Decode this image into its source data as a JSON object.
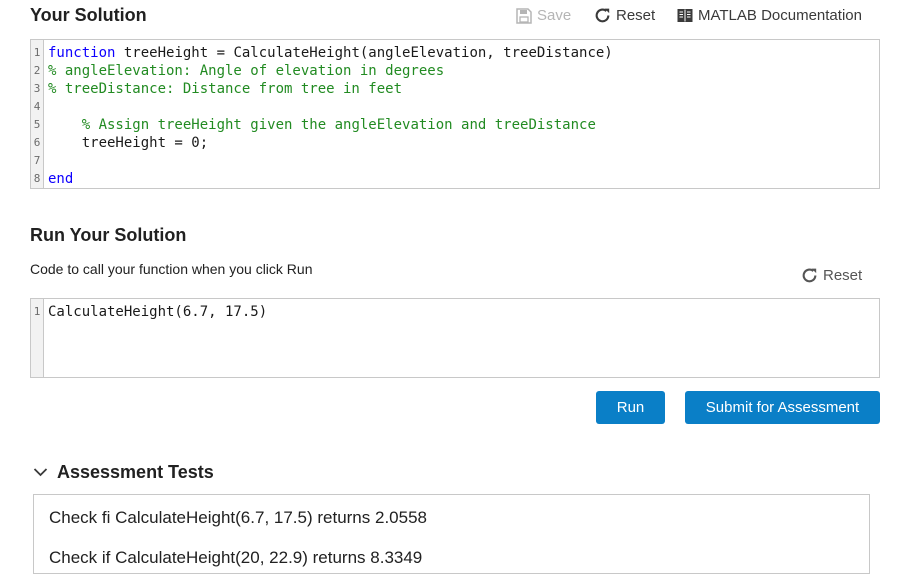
{
  "solution": {
    "title": "Your Solution",
    "save_label": "Save",
    "reset_label": "Reset",
    "docs_label": "MATLAB Documentation",
    "lines": [
      {
        "n": "1",
        "kw": "function",
        "text": " treeHeight = CalculateHeight(angleElevation, treeDistance)",
        "comment": ""
      },
      {
        "n": "2",
        "kw": "",
        "text": "",
        "comment": "% angleElevation: Angle of elevation in degrees"
      },
      {
        "n": "3",
        "kw": "",
        "text": "",
        "comment": "% treeDistance: Distance from tree in feet"
      },
      {
        "n": "4",
        "kw": "",
        "text": "",
        "comment": ""
      },
      {
        "n": "5",
        "kw": "",
        "text": "    ",
        "comment": "% Assign treeHeight given the angleElevation and treeDistance"
      },
      {
        "n": "6",
        "kw": "",
        "text": "    treeHeight = 0;",
        "comment": ""
      },
      {
        "n": "7",
        "kw": "",
        "text": "",
        "comment": ""
      },
      {
        "n": "8",
        "kw": "end",
        "text": "",
        "comment": ""
      }
    ]
  },
  "run": {
    "title": "Run Your Solution",
    "subtitle": "Code to call your function when you click Run",
    "reset_label": "Reset",
    "lines": [
      {
        "n": "1",
        "kw": "",
        "text": "CalculateHeight(6.7, 17.5)",
        "comment": ""
      }
    ],
    "run_label": "Run",
    "submit_label": "Submit for Assessment"
  },
  "tests": {
    "title": "Assessment Tests",
    "items": [
      "Check fi CalculateHeight(6.7, 17.5) returns 2.0558",
      "Check if CalculateHeight(20, 22.9) returns 8.3349"
    ]
  },
  "colors": {
    "primary_button": "#0a7fc7",
    "keyword": "#0e00ff",
    "comment": "#228b22"
  },
  "icons": {
    "save": "floppy-disk-icon",
    "reset": "circular-arrow-icon",
    "docs": "book-icon",
    "collapse": "chevron-down-icon"
  }
}
